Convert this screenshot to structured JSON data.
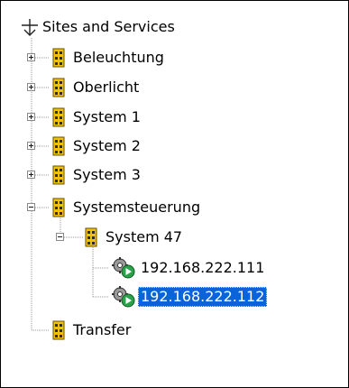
{
  "tree": {
    "root": {
      "label": "Sites and Services",
      "icon": "sites-services-icon"
    },
    "items": [
      {
        "label": "Beleuchtung",
        "icon": "building-icon",
        "expander": "plus"
      },
      {
        "label": "Oberlicht",
        "icon": "building-icon",
        "expander": "plus"
      },
      {
        "label": "System 1",
        "icon": "building-icon",
        "expander": "plus"
      },
      {
        "label": "System 2",
        "icon": "building-icon",
        "expander": "plus"
      },
      {
        "label": "System 3",
        "icon": "building-icon",
        "expander": "plus"
      },
      {
        "label": "Systemsteuerung",
        "icon": "building-icon",
        "expander": "minus",
        "children": [
          {
            "label": "System 47",
            "icon": "building-icon",
            "expander": "minus",
            "children": [
              {
                "label": "192.168.222.111",
                "icon": "server-gear-icon",
                "selected": false
              },
              {
                "label": "192.168.222.112",
                "icon": "server-gear-icon",
                "selected": true
              }
            ]
          }
        ]
      },
      {
        "label": "Transfer",
        "icon": "building-icon",
        "expander": "none"
      }
    ]
  },
  "colors": {
    "selection": "#0a64d8",
    "building": "#f2c200",
    "gear_play": "#2aa24a"
  }
}
